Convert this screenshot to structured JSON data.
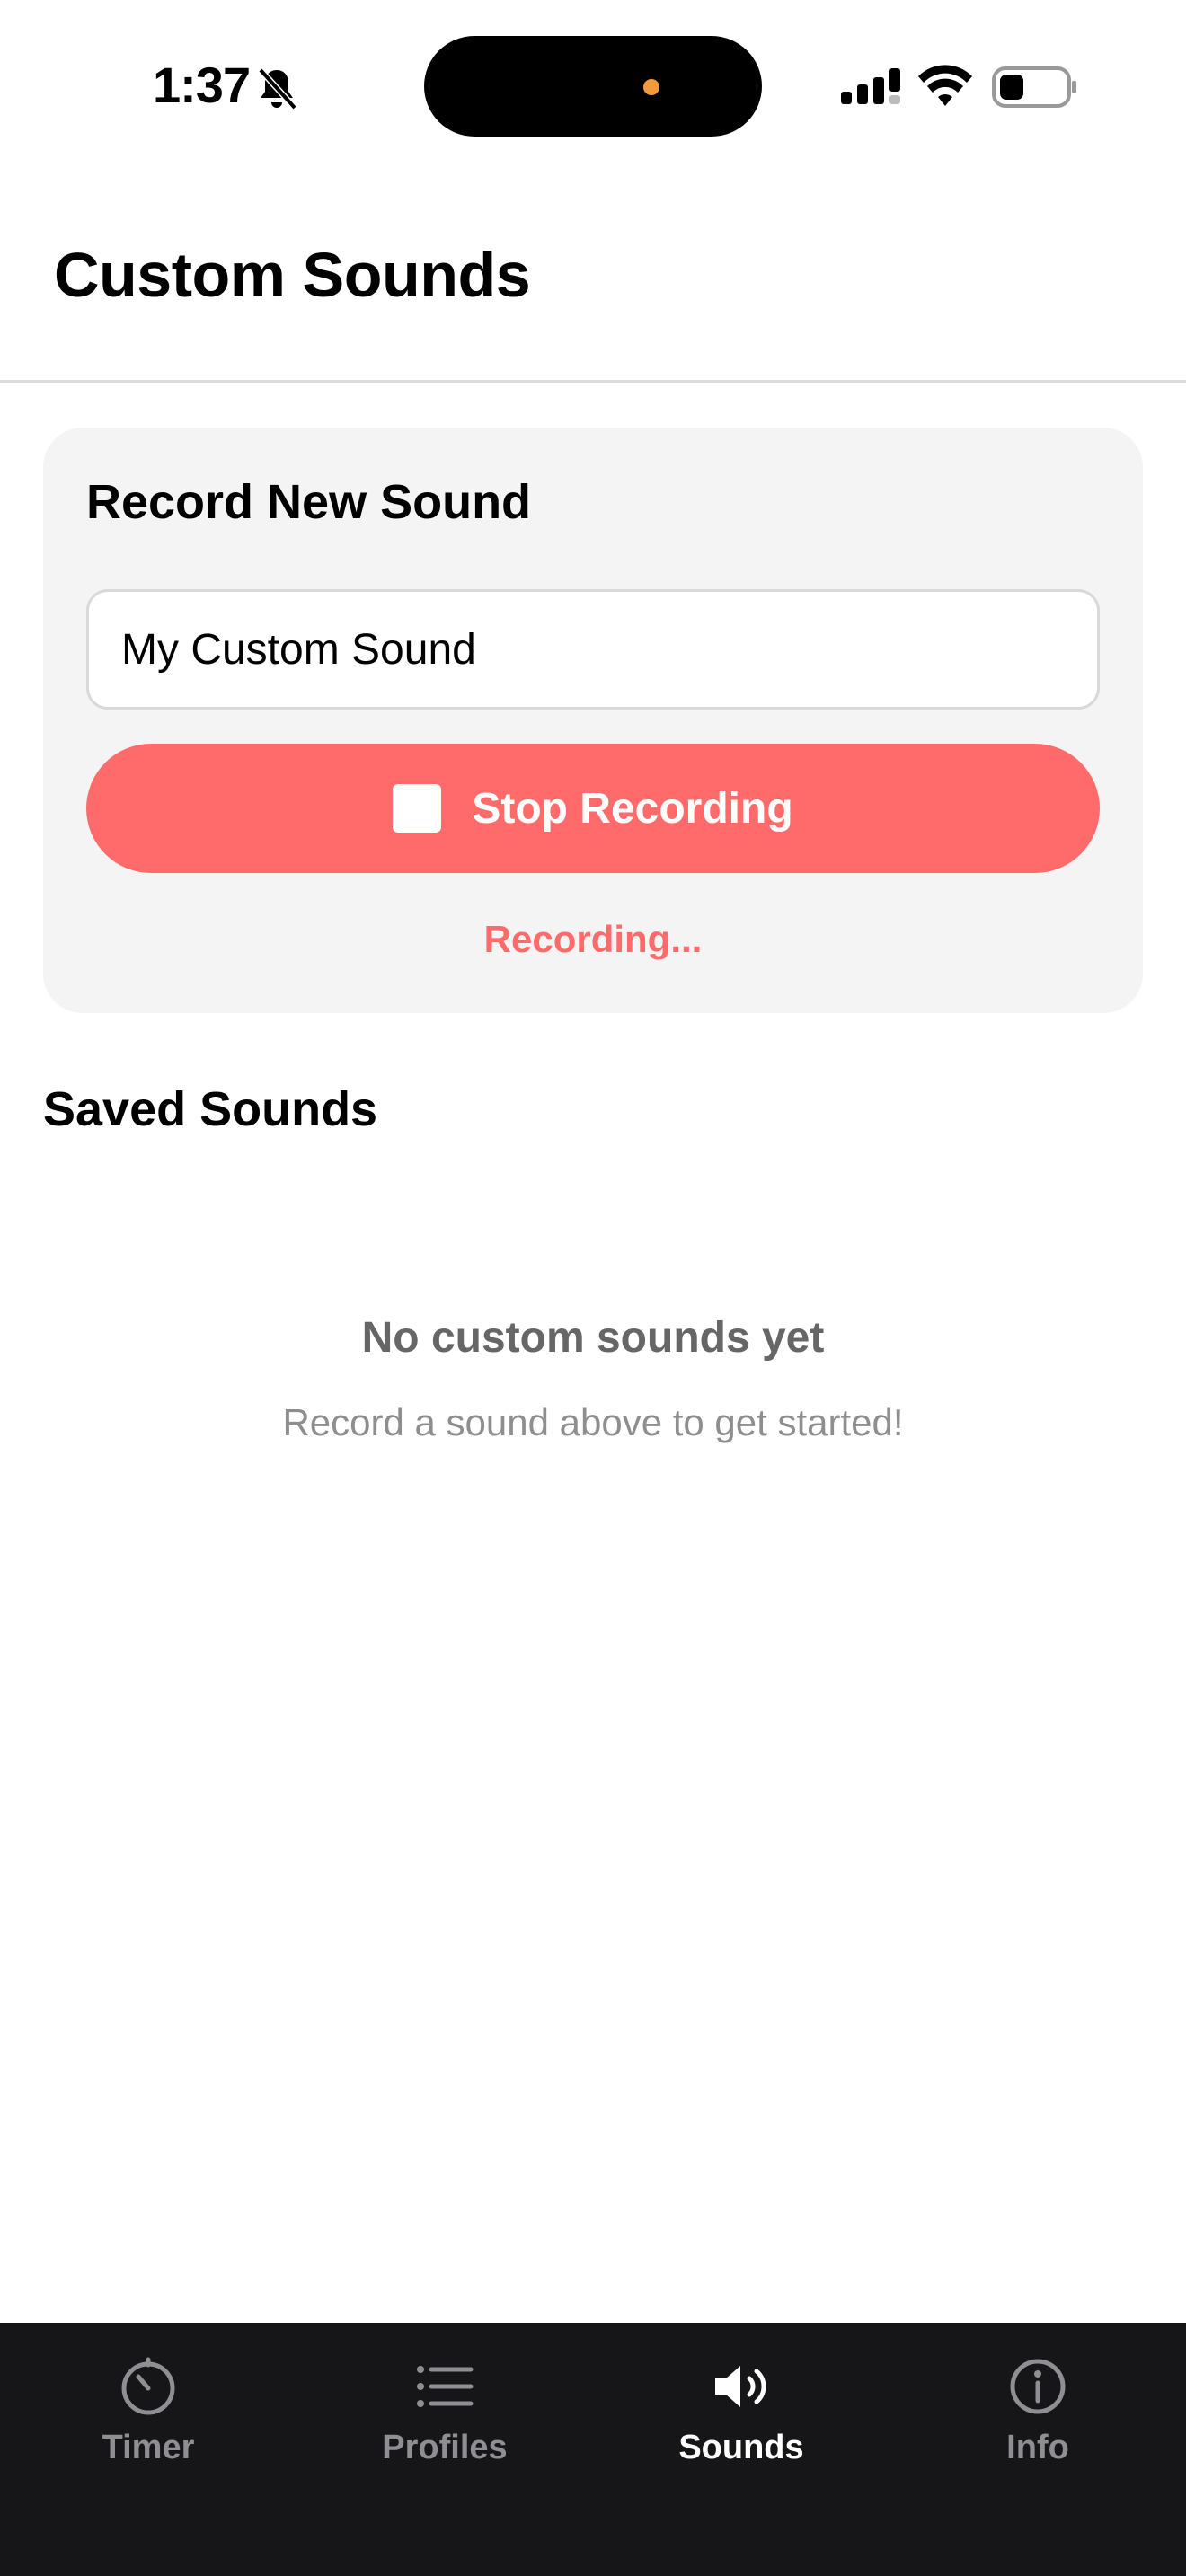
{
  "status_bar": {
    "time": "1:37"
  },
  "header": {
    "title": "Custom Sounds"
  },
  "record_section": {
    "title": "Record New Sound",
    "name_value": "My Custom Sound",
    "button_label": "Stop Recording",
    "status": "Recording..."
  },
  "saved_section": {
    "title": "Saved Sounds",
    "empty_title": "No custom sounds yet",
    "empty_subtitle": "Record a sound above to get started!"
  },
  "tab_bar": {
    "items": [
      {
        "label": "Timer",
        "icon": "timer-icon"
      },
      {
        "label": "Profiles",
        "icon": "list-icon"
      },
      {
        "label": "Sounds",
        "icon": "speaker-icon",
        "active": true
      },
      {
        "label": "Info",
        "icon": "info-icon"
      }
    ]
  },
  "colors": {
    "accent": "#ff6b6b",
    "tab_bar_bg": "#161618",
    "tab_inactive": "#8e8e93",
    "tab_active": "#ffffff"
  }
}
